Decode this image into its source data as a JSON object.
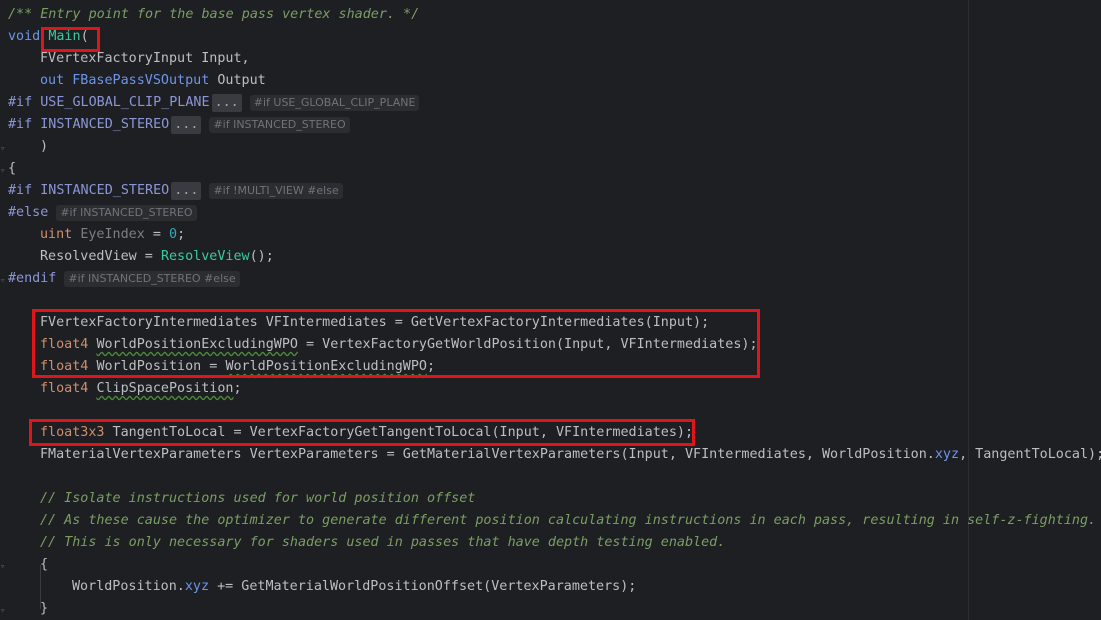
{
  "code": {
    "l1": "/** Entry point for the base pass vertex shader. */",
    "l2_kw": "void",
    "l2_fn": "Main",
    "l2_paren": "(",
    "l3": "FVertexFactoryInput Input,",
    "l4_kw": "out",
    "l4_type": "FBasePassVSOutput",
    "l4_rest": " Output",
    "l5_pp": "#if",
    "l5_sym": "USE_GLOBAL_CLIP_PLANE",
    "l5_fold": "...",
    "l5_hint": "#if USE_GLOBAL_CLIP_PLANE",
    "l6_pp": "#if",
    "l6_sym": "INSTANCED_STEREO",
    "l6_fold": "...",
    "l6_hint": "#if INSTANCED_STEREO",
    "l7": ")",
    "l8": "{",
    "l9_pp": "#if",
    "l9_sym": "INSTANCED_STEREO",
    "l9_fold": "...",
    "l9_hint": "#if !MULTI_VIEW #else",
    "l10_pp": "#else",
    "l10_hint": "#if INSTANCED_STEREO",
    "l11_kw": "uint",
    "l11_var": "EyeIndex",
    "l11_op": " = ",
    "l11_num": "0",
    "l11_end": ";",
    "l12_a": "ResolvedView = ",
    "l12_fn": "ResolveView",
    "l12_b": "();",
    "l13_pp": "#endif",
    "l13_hint": "#if INSTANCED_STEREO #else",
    "l14": "FVertexFactoryIntermediates VFIntermediates = GetVertexFactoryIntermediates(Input);",
    "l15_kw": "float4",
    "l15_var": "WorldPositionExcludingWPO",
    "l15_rest": " = VertexFactoryGetWorldPosition(Input, VFIntermediates);",
    "l16_kw": "float4",
    "l16_var": "WorldPosition",
    "l16_mid": " = ",
    "l16_ref": "WorldPositionExcludingWPO",
    "l16_end": ";",
    "l17_kw": "float4",
    "l17_var": "ClipSpacePosition",
    "l17_end": ";",
    "l18_kw": "float3x3",
    "l18_rest": " TangentToLocal = VertexFactoryGetTangentToLocal(Input, VFIntermediates);",
    "l19_a": "FMaterialVertexParameters VertexParameters = GetMaterialVertexParameters(Input, VFIntermediates, WorldPosition.",
    "l19_sw": "xyz",
    "l19_b": ", TangentToLocal);",
    "l20": "// Isolate instructions used for world position offset",
    "l21": "// As these cause the optimizer to generate different position calculating instructions in each pass, resulting in self-z-fighting.",
    "l22": "// This is only necessary for shaders used in passes that have depth testing enabled.",
    "l23": "{",
    "l24_a": "WorldPosition.",
    "l24_sw": "xyz",
    "l24_b": " += GetMaterialWorldPositionOffset(VertexParameters);",
    "l25": "}"
  },
  "colors": {
    "background": "#1e1f22",
    "highlight_box": "#e0151a",
    "comment": "#7a9e62",
    "keyword": "#cf8e6d",
    "function": "#39cc9b"
  }
}
